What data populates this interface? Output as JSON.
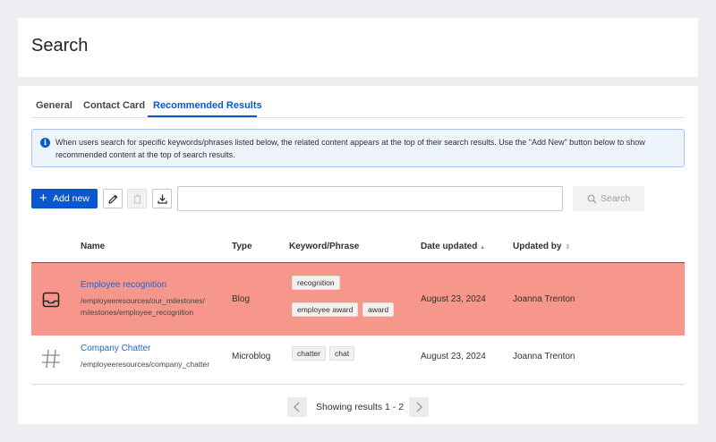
{
  "page": {
    "title": "Search"
  },
  "tabs": [
    {
      "label": "General",
      "active": false
    },
    {
      "label": "Contact Card",
      "active": false
    },
    {
      "label": "Recommended Results",
      "active": true
    }
  ],
  "info": {
    "text": "When users search for specific keywords/phrases listed below, the related content appears at the top of their search results. Use the \"Add New\" button below to show recommended content at the top of search results."
  },
  "toolbar": {
    "add_label": "Add new",
    "edit_icon": "pencil-icon",
    "delete_icon": "trash-icon",
    "download_icon": "download-icon",
    "search_value": "",
    "search_placeholder": "",
    "search_label": "Search"
  },
  "table": {
    "columns": [
      "Name",
      "Type",
      "Keyword/Phrase",
      "Date updated",
      "Updated by"
    ],
    "rows": [
      {
        "icon": "inbox-tray-icon",
        "name": "Employee recognition",
        "path_line1": "/employeeresources/our_milestones/",
        "path_line2": "milestones/employee_recognition",
        "type": "Blog",
        "keywords": [
          "recognition",
          "employee award",
          "award"
        ],
        "date": "August 23, 2024",
        "updated_by": "Joanna Trenton",
        "highlighted": true
      },
      {
        "icon": "hashtag-icon",
        "name": "Company Chatter",
        "path_line1": "/employeeresources/company_chatter",
        "type": "Microblog",
        "keywords": [
          "chatter",
          "chat"
        ],
        "date": "August 23, 2024",
        "updated_by": "Joanna Trenton",
        "highlighted": false
      }
    ]
  },
  "pagination": {
    "text": "Showing results 1 - 2"
  },
  "colors": {
    "accent": "#0b57d0",
    "highlight_row": "#f7968a",
    "link": "#2266cc"
  }
}
